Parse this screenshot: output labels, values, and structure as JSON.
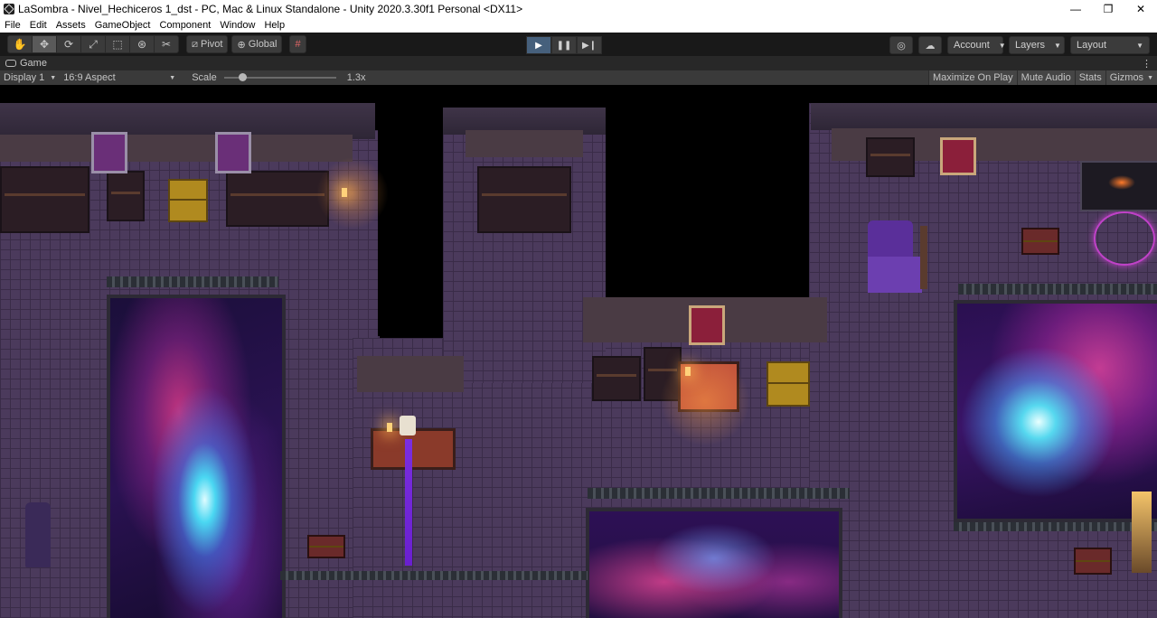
{
  "window": {
    "title": "LaSombra - Nivel_Hechiceros 1_dst - PC, Mac & Linux Standalone - Unity 2020.3.30f1 Personal <DX11>",
    "controls": [
      "—",
      "❐",
      "✕"
    ]
  },
  "menu": [
    "File",
    "Edit",
    "Assets",
    "GameObject",
    "Component",
    "Window",
    "Help"
  ],
  "toolbar": {
    "pivot_label": "Pivot",
    "global_label": "Global",
    "account_label": "Account",
    "layers_label": "Layers",
    "layout_label": "Layout"
  },
  "game_tab": {
    "label": "Game"
  },
  "game_bar": {
    "display": "Display 1",
    "aspect": "16:9 Aspect",
    "scale_label": "Scale",
    "scale_value": "1.3x",
    "maximize": "Maximize On Play",
    "mute": "Mute Audio",
    "stats": "Stats",
    "gizmos": "Gizmos"
  },
  "colors": {
    "play_active": "#46607c",
    "toolbar_bg": "#191919",
    "floor": "#4b3a5c"
  }
}
